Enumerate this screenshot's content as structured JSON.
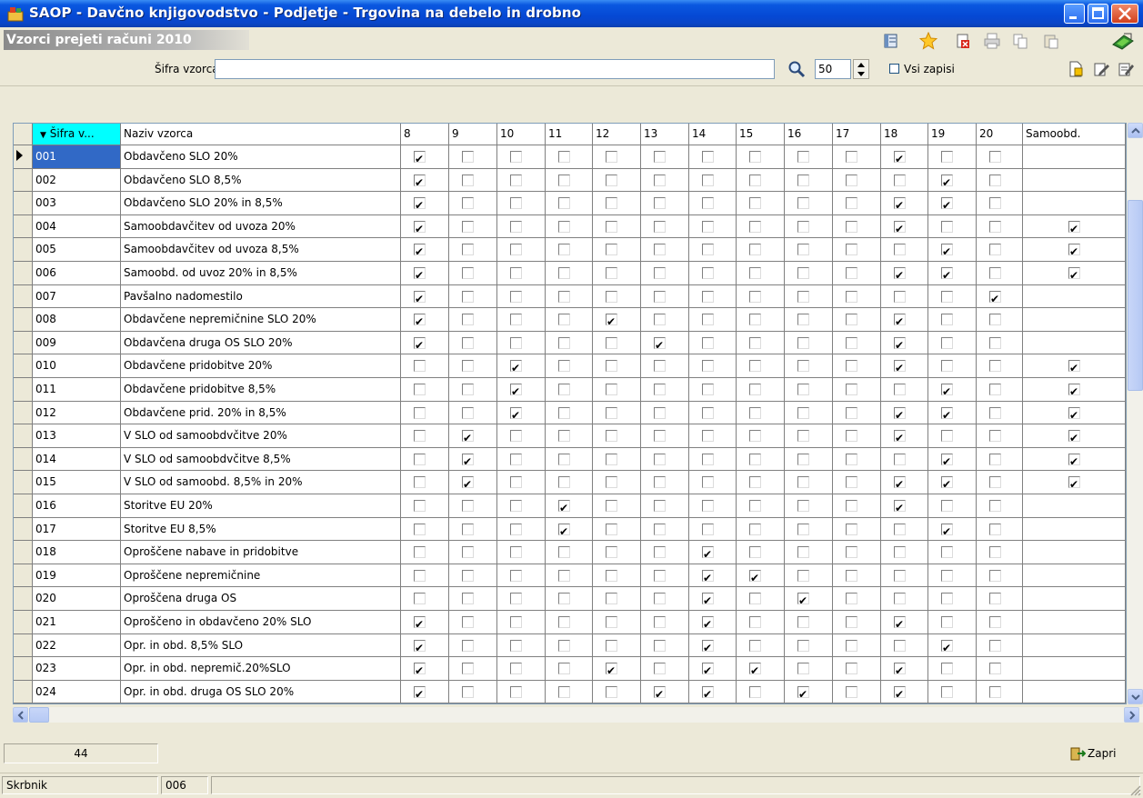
{
  "window": {
    "title": "SAOP - Davčno knjigovodstvo - Podjetje - Trgovina na debelo in drobno",
    "subtitle": "Vzorci prejeti računi 2010"
  },
  "toolbar": {
    "icons": [
      "layout-icon",
      "favorite-star-icon",
      "delete-icon",
      "print-icon",
      "copy-icon",
      "paste-icon",
      "exit-icon"
    ]
  },
  "filter": {
    "label": "Šifra vzorca",
    "value": "",
    "count": "50",
    "all_records_label": "Vsi zapisi",
    "all_records_checked": false
  },
  "grid": {
    "columns": [
      "Šifra v...",
      "Naziv vzorca",
      "8",
      "9",
      "10",
      "11",
      "12",
      "13",
      "14",
      "15",
      "16",
      "17",
      "18",
      "19",
      "20",
      "Samoobd."
    ],
    "rows": [
      {
        "code": "001",
        "name": "Obdavčeno SLO 20%",
        "checks": [
          8,
          18
        ],
        "samo": false
      },
      {
        "code": "002",
        "name": "Obdavčeno SLO 8,5%",
        "checks": [
          8,
          19
        ],
        "samo": false
      },
      {
        "code": "003",
        "name": "Obdavčeno SLO 20% in 8,5%",
        "checks": [
          8,
          18,
          19
        ],
        "samo": false
      },
      {
        "code": "004",
        "name": "Samoobdavčitev od uvoza 20%",
        "checks": [
          8,
          18
        ],
        "samo": true
      },
      {
        "code": "005",
        "name": "Samoobdavčitev od uvoza 8,5%",
        "checks": [
          8,
          19
        ],
        "samo": true
      },
      {
        "code": "006",
        "name": "Samoobd. od uvoz 20% in 8,5%",
        "checks": [
          8,
          18,
          19
        ],
        "samo": true
      },
      {
        "code": "007",
        "name": "Pavšalno nadomestilo",
        "checks": [
          8,
          20
        ],
        "samo": false
      },
      {
        "code": "008",
        "name": "Obdavčene nepremičnine SLO 20%",
        "checks": [
          8,
          12,
          18
        ],
        "samo": false
      },
      {
        "code": "009",
        "name": "Obdavčena druga  OS SLO 20%",
        "checks": [
          8,
          13,
          18
        ],
        "samo": false
      },
      {
        "code": "010",
        "name": "Obdavčene pridobitve 20%",
        "checks": [
          10,
          18
        ],
        "samo": true
      },
      {
        "code": "011",
        "name": "Obdavčene pridobitve 8,5%",
        "checks": [
          10,
          19
        ],
        "samo": true
      },
      {
        "code": "012",
        "name": "Obdavčene prid. 20% in 8,5%",
        "checks": [
          10,
          18,
          19
        ],
        "samo": true
      },
      {
        "code": "013",
        "name": "V SLO od samoobdvčitve 20%",
        "checks": [
          9,
          18
        ],
        "samo": true
      },
      {
        "code": "014",
        "name": "V SLO od samoobdvčitve 8,5%",
        "checks": [
          9,
          19
        ],
        "samo": true
      },
      {
        "code": "015",
        "name": "V SLO od samoobd. 8,5% in 20%",
        "checks": [
          9,
          18,
          19
        ],
        "samo": true
      },
      {
        "code": "016",
        "name": "Storitve EU 20%",
        "checks": [
          11,
          18
        ],
        "samo": false
      },
      {
        "code": "017",
        "name": "Storitve EU 8,5%",
        "checks": [
          11,
          19
        ],
        "samo": false
      },
      {
        "code": "018",
        "name": "Oproščene nabave in pridobitve",
        "checks": [
          14
        ],
        "samo": false
      },
      {
        "code": "019",
        "name": "Oproščene nepremičnine",
        "checks": [
          14,
          15
        ],
        "samo": false
      },
      {
        "code": "020",
        "name": "Oproščena druga OS",
        "checks": [
          14,
          16
        ],
        "samo": false
      },
      {
        "code": "021",
        "name": "Oproščeno in obdavčeno 20% SLO",
        "checks": [
          8,
          14,
          18
        ],
        "samo": false
      },
      {
        "code": "022",
        "name": "Opr. in obd. 8,5% SLO",
        "checks": [
          8,
          14,
          19
        ],
        "samo": false
      },
      {
        "code": "023",
        "name": "Opr. in obd. nepremič.20%SLO",
        "checks": [
          8,
          12,
          14,
          15,
          18
        ],
        "samo": false
      },
      {
        "code": "024",
        "name": "Opr. in obd. druga OS SLO 20%",
        "checks": [
          8,
          13,
          14,
          16,
          18
        ],
        "samo": false
      }
    ]
  },
  "footer": {
    "count": "44",
    "close_label": "Zapri"
  },
  "status": {
    "user": "Skrbnik",
    "code": "006"
  },
  "colors": {
    "title_blue": "#0548D4",
    "selected_row": "#3169C6",
    "sorted_header": "#00FFFF",
    "face": "#ECE9D8"
  }
}
